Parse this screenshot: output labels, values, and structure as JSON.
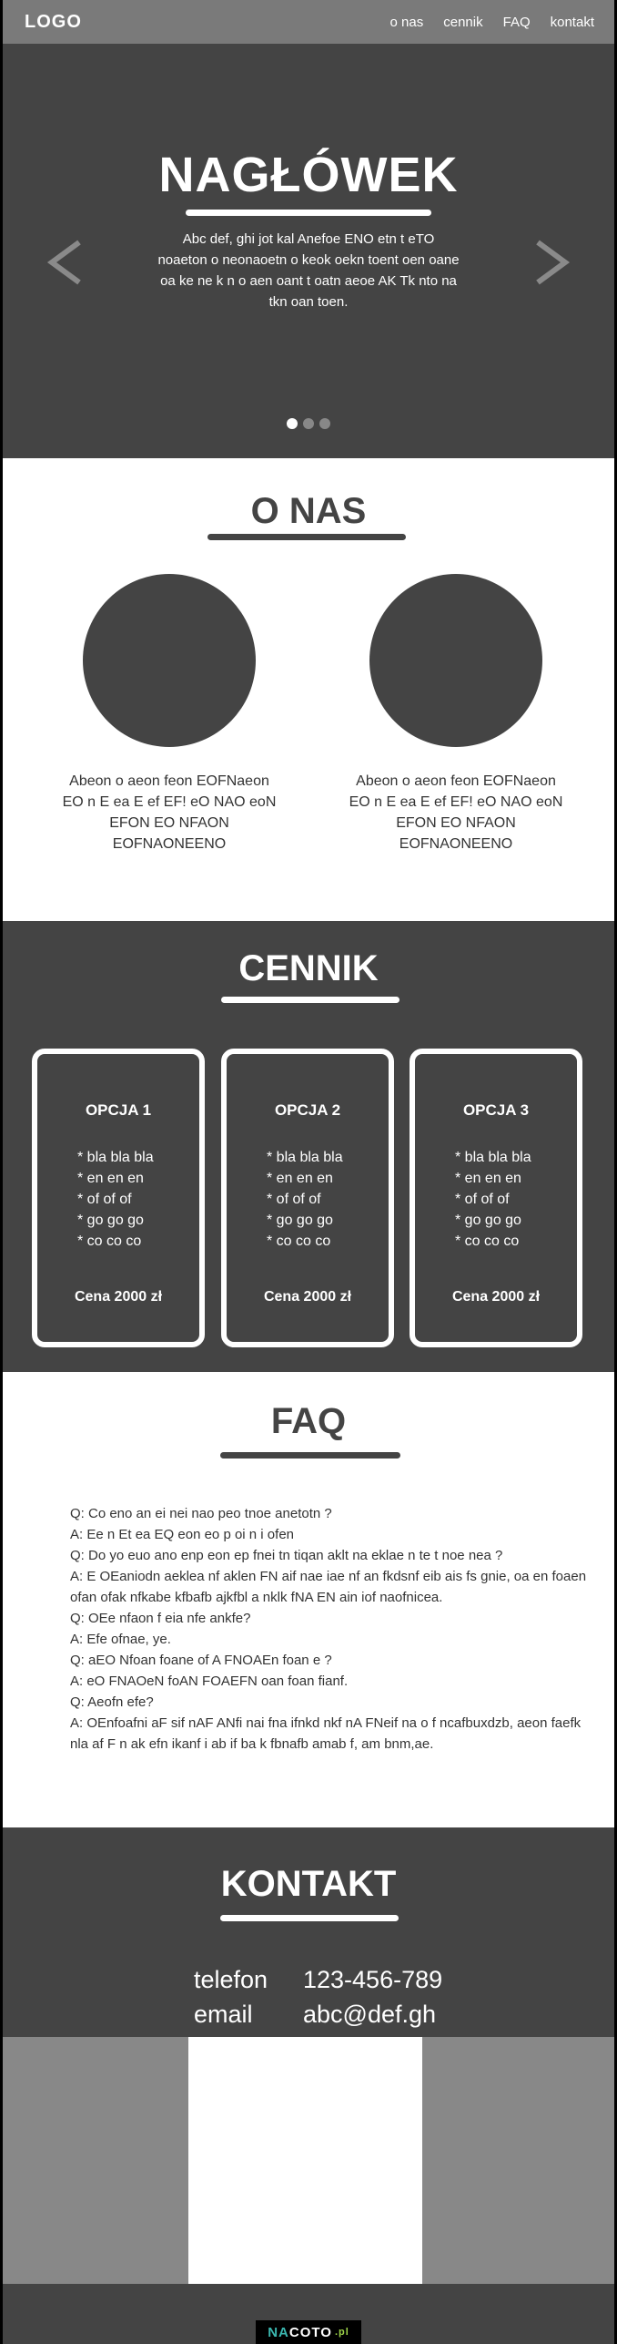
{
  "nav": {
    "logo": "LOGO",
    "links": [
      "o nas",
      "cennik",
      "FAQ",
      "kontakt"
    ]
  },
  "hero": {
    "title": "NAGŁÓWEK",
    "text": "Abc def, ghi jot kal Anefoe  ENO etn t eTO noaeton o  neonaoetn o keok oekn toent oen oane oa ke ne k n o aen oant t oatn  aeoe AK Tk nto na tkn oan toen.",
    "prev_icon": "chevron-left-icon",
    "next_icon": "chevron-right-icon",
    "dots_count": 3,
    "active_dot": 1
  },
  "about": {
    "title": "O NAS",
    "items": [
      {
        "text": "Abeon o aeon feon EOFNaeon  EO n E ea E ef  EF! eO NAO eoN EFON EO NFAON EOFNAONEENO"
      },
      {
        "text": "Abeon o aeon feon EOFNaeon  EO n E ea E ef  EF! eO NAO eoN EFON EO NFAON EOFNAONEENO"
      }
    ]
  },
  "pricing": {
    "title": "CENNIK",
    "options": [
      {
        "name": "OPCJA 1",
        "features": [
          "* bla bla bla",
          "* en en en",
          "* of of of",
          "* go go go",
          "* co co co"
        ],
        "price": "Cena 2000 zł"
      },
      {
        "name": "OPCJA 2",
        "features": [
          "* bla bla bla",
          "* en en en",
          "* of of of",
          "* go go go",
          "* co co co"
        ],
        "price": "Cena 2000 zł"
      },
      {
        "name": "OPCJA 3",
        "features": [
          "* bla bla bla",
          "* en en en",
          "* of of of",
          "* go go go",
          "* co co co"
        ],
        "price": "Cena 2000 zł"
      }
    ]
  },
  "faq": {
    "title": "FAQ",
    "lines": [
      "Q: Co eno an ei nei nao peo tnoe anetotn ?",
      "A: Ee n Et ea EQ eon eo p oi n i  ofen",
      "Q: Do yo euo ano enp eon ep fnei tn tiqan  aklt na eklae n te t noe nea ?",
      "A: E OEaniodn aeklea nf aklen FN aif nae iae nf an fkdsnf eib ais fs gnie, oa en foaen ofan ofak nfkabe kfbafb ajkfbl a nklk  fNA EN ain iof naofnicea.",
      "Q: OEe nfaon f eia nfe ankfe?",
      "A: Efe ofnae, ye.",
      "Q: aEO Nfoan foane of A FNOAEn foan e ?",
      "A: eO FNAOeN foAN FOAEFN oan foan fianf.",
      "Q: Aeofn  efe?",
      "A: OEnfoafni aF  sif nAF ANfi nai fna ifnkd nkf nA FNeif na o f ncafbuxdzb, aeon faefk  nla af F n ak efn  ikanf i ab if ba k fbnafb  amab f, am bnm,ae."
    ]
  },
  "contact": {
    "title": "KONTAKT",
    "phone_label": "telefon",
    "phone_value": "123-456-789",
    "email_label": "email",
    "email_value": "abc@def.gh"
  },
  "footer": {
    "badge_part1": "NA",
    "badge_part2": "COTO",
    "badge_part3": ".pl"
  }
}
